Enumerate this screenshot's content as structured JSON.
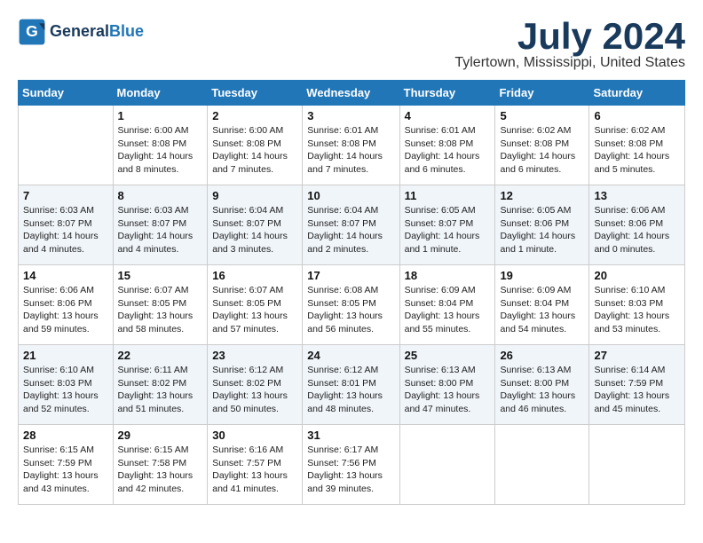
{
  "header": {
    "logo_line1": "General",
    "logo_line2": "Blue",
    "month_title": "July 2024",
    "location": "Tylertown, Mississippi, United States"
  },
  "days_of_week": [
    "Sunday",
    "Monday",
    "Tuesday",
    "Wednesday",
    "Thursday",
    "Friday",
    "Saturday"
  ],
  "weeks": [
    [
      {
        "day": "",
        "sunrise": "",
        "sunset": "",
        "daylight": ""
      },
      {
        "day": "1",
        "sunrise": "Sunrise: 6:00 AM",
        "sunset": "Sunset: 8:08 PM",
        "daylight": "Daylight: 14 hours and 8 minutes."
      },
      {
        "day": "2",
        "sunrise": "Sunrise: 6:00 AM",
        "sunset": "Sunset: 8:08 PM",
        "daylight": "Daylight: 14 hours and 7 minutes."
      },
      {
        "day": "3",
        "sunrise": "Sunrise: 6:01 AM",
        "sunset": "Sunset: 8:08 PM",
        "daylight": "Daylight: 14 hours and 7 minutes."
      },
      {
        "day": "4",
        "sunrise": "Sunrise: 6:01 AM",
        "sunset": "Sunset: 8:08 PM",
        "daylight": "Daylight: 14 hours and 6 minutes."
      },
      {
        "day": "5",
        "sunrise": "Sunrise: 6:02 AM",
        "sunset": "Sunset: 8:08 PM",
        "daylight": "Daylight: 14 hours and 6 minutes."
      },
      {
        "day": "6",
        "sunrise": "Sunrise: 6:02 AM",
        "sunset": "Sunset: 8:08 PM",
        "daylight": "Daylight: 14 hours and 5 minutes."
      }
    ],
    [
      {
        "day": "7",
        "sunrise": "Sunrise: 6:03 AM",
        "sunset": "Sunset: 8:07 PM",
        "daylight": "Daylight: 14 hours and 4 minutes."
      },
      {
        "day": "8",
        "sunrise": "Sunrise: 6:03 AM",
        "sunset": "Sunset: 8:07 PM",
        "daylight": "Daylight: 14 hours and 4 minutes."
      },
      {
        "day": "9",
        "sunrise": "Sunrise: 6:04 AM",
        "sunset": "Sunset: 8:07 PM",
        "daylight": "Daylight: 14 hours and 3 minutes."
      },
      {
        "day": "10",
        "sunrise": "Sunrise: 6:04 AM",
        "sunset": "Sunset: 8:07 PM",
        "daylight": "Daylight: 14 hours and 2 minutes."
      },
      {
        "day": "11",
        "sunrise": "Sunrise: 6:05 AM",
        "sunset": "Sunset: 8:07 PM",
        "daylight": "Daylight: 14 hours and 1 minute."
      },
      {
        "day": "12",
        "sunrise": "Sunrise: 6:05 AM",
        "sunset": "Sunset: 8:06 PM",
        "daylight": "Daylight: 14 hours and 1 minute."
      },
      {
        "day": "13",
        "sunrise": "Sunrise: 6:06 AM",
        "sunset": "Sunset: 8:06 PM",
        "daylight": "Daylight: 14 hours and 0 minutes."
      }
    ],
    [
      {
        "day": "14",
        "sunrise": "Sunrise: 6:06 AM",
        "sunset": "Sunset: 8:06 PM",
        "daylight": "Daylight: 13 hours and 59 minutes."
      },
      {
        "day": "15",
        "sunrise": "Sunrise: 6:07 AM",
        "sunset": "Sunset: 8:05 PM",
        "daylight": "Daylight: 13 hours and 58 minutes."
      },
      {
        "day": "16",
        "sunrise": "Sunrise: 6:07 AM",
        "sunset": "Sunset: 8:05 PM",
        "daylight": "Daylight: 13 hours and 57 minutes."
      },
      {
        "day": "17",
        "sunrise": "Sunrise: 6:08 AM",
        "sunset": "Sunset: 8:05 PM",
        "daylight": "Daylight: 13 hours and 56 minutes."
      },
      {
        "day": "18",
        "sunrise": "Sunrise: 6:09 AM",
        "sunset": "Sunset: 8:04 PM",
        "daylight": "Daylight: 13 hours and 55 minutes."
      },
      {
        "day": "19",
        "sunrise": "Sunrise: 6:09 AM",
        "sunset": "Sunset: 8:04 PM",
        "daylight": "Daylight: 13 hours and 54 minutes."
      },
      {
        "day": "20",
        "sunrise": "Sunrise: 6:10 AM",
        "sunset": "Sunset: 8:03 PM",
        "daylight": "Daylight: 13 hours and 53 minutes."
      }
    ],
    [
      {
        "day": "21",
        "sunrise": "Sunrise: 6:10 AM",
        "sunset": "Sunset: 8:03 PM",
        "daylight": "Daylight: 13 hours and 52 minutes."
      },
      {
        "day": "22",
        "sunrise": "Sunrise: 6:11 AM",
        "sunset": "Sunset: 8:02 PM",
        "daylight": "Daylight: 13 hours and 51 minutes."
      },
      {
        "day": "23",
        "sunrise": "Sunrise: 6:12 AM",
        "sunset": "Sunset: 8:02 PM",
        "daylight": "Daylight: 13 hours and 50 minutes."
      },
      {
        "day": "24",
        "sunrise": "Sunrise: 6:12 AM",
        "sunset": "Sunset: 8:01 PM",
        "daylight": "Daylight: 13 hours and 48 minutes."
      },
      {
        "day": "25",
        "sunrise": "Sunrise: 6:13 AM",
        "sunset": "Sunset: 8:00 PM",
        "daylight": "Daylight: 13 hours and 47 minutes."
      },
      {
        "day": "26",
        "sunrise": "Sunrise: 6:13 AM",
        "sunset": "Sunset: 8:00 PM",
        "daylight": "Daylight: 13 hours and 46 minutes."
      },
      {
        "day": "27",
        "sunrise": "Sunrise: 6:14 AM",
        "sunset": "Sunset: 7:59 PM",
        "daylight": "Daylight: 13 hours and 45 minutes."
      }
    ],
    [
      {
        "day": "28",
        "sunrise": "Sunrise: 6:15 AM",
        "sunset": "Sunset: 7:59 PM",
        "daylight": "Daylight: 13 hours and 43 minutes."
      },
      {
        "day": "29",
        "sunrise": "Sunrise: 6:15 AM",
        "sunset": "Sunset: 7:58 PM",
        "daylight": "Daylight: 13 hours and 42 minutes."
      },
      {
        "day": "30",
        "sunrise": "Sunrise: 6:16 AM",
        "sunset": "Sunset: 7:57 PM",
        "daylight": "Daylight: 13 hours and 41 minutes."
      },
      {
        "day": "31",
        "sunrise": "Sunrise: 6:17 AM",
        "sunset": "Sunset: 7:56 PM",
        "daylight": "Daylight: 13 hours and 39 minutes."
      },
      {
        "day": "",
        "sunrise": "",
        "sunset": "",
        "daylight": ""
      },
      {
        "day": "",
        "sunrise": "",
        "sunset": "",
        "daylight": ""
      },
      {
        "day": "",
        "sunrise": "",
        "sunset": "",
        "daylight": ""
      }
    ]
  ]
}
